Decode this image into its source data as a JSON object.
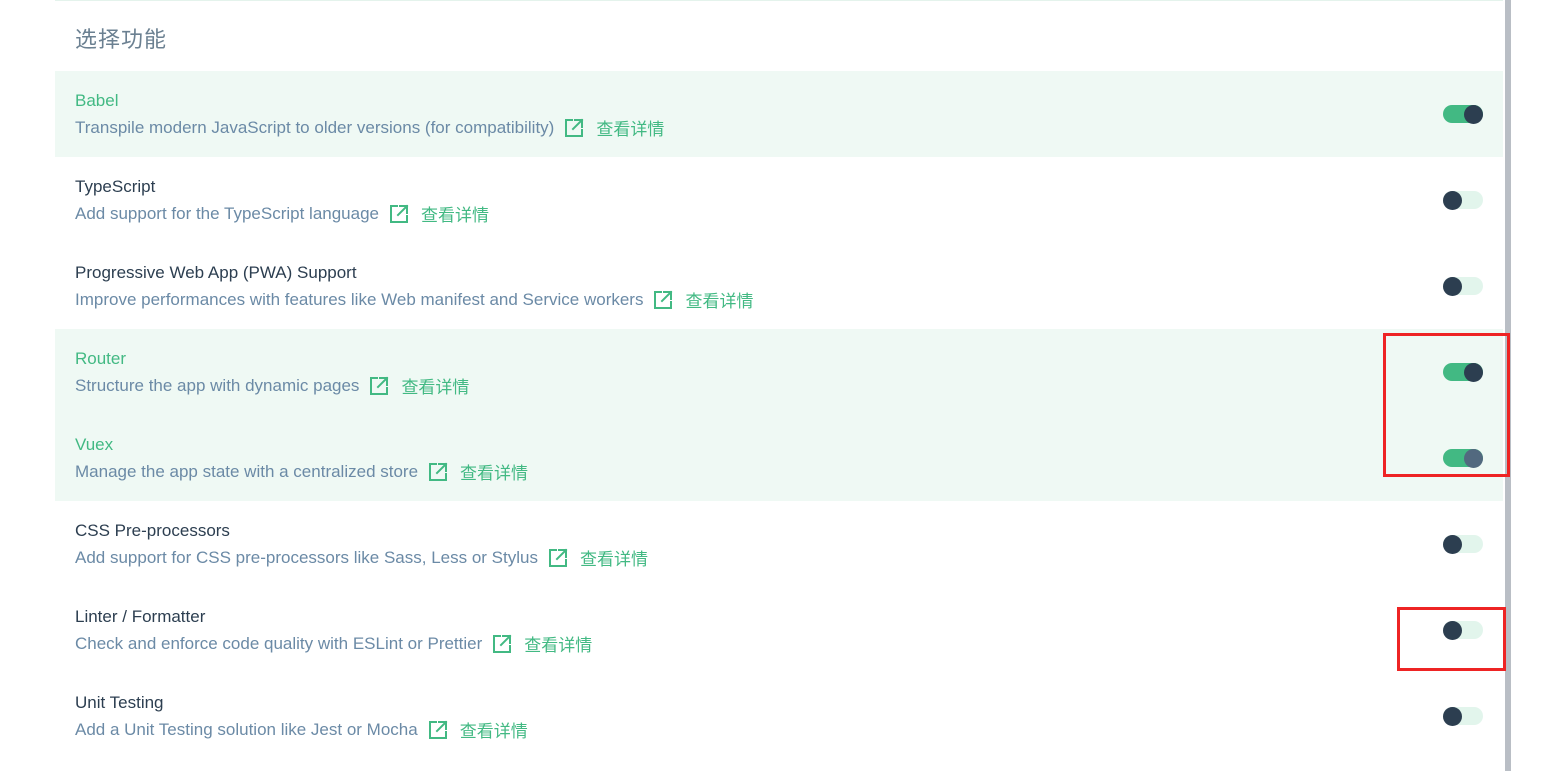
{
  "section": {
    "title": "选择功能"
  },
  "link_label": "查看详情",
  "features": [
    {
      "name": "Babel",
      "description": "Transpile modern JavaScript to older versions (for compatibility)",
      "enabled": true
    },
    {
      "name": "TypeScript",
      "description": "Add support for the TypeScript language",
      "enabled": false
    },
    {
      "name": "Progressive Web App (PWA) Support",
      "description": "Improve performances with features like Web manifest and Service workers",
      "enabled": false
    },
    {
      "name": "Router",
      "description": "Structure the app with dynamic pages",
      "enabled": true
    },
    {
      "name": "Vuex",
      "description": "Manage the app state with a centralized store",
      "enabled": true
    },
    {
      "name": "CSS Pre-processors",
      "description": "Add support for CSS pre-processors like Sass, Less or Stylus",
      "enabled": false
    },
    {
      "name": "Linter / Formatter",
      "description": "Check and enforce code quality with ESLint or Prettier",
      "enabled": false
    },
    {
      "name": "Unit Testing",
      "description": "Add a Unit Testing solution like Jest or Mocha",
      "enabled": false
    }
  ],
  "colors": {
    "accent": "#42b983",
    "text_dark": "#2c3e50",
    "text_muted": "#6b8aa6",
    "selected_row_bg": "#eff9f4",
    "annotation": "#ee2424"
  },
  "icons": {
    "link": "external-link-icon"
  }
}
